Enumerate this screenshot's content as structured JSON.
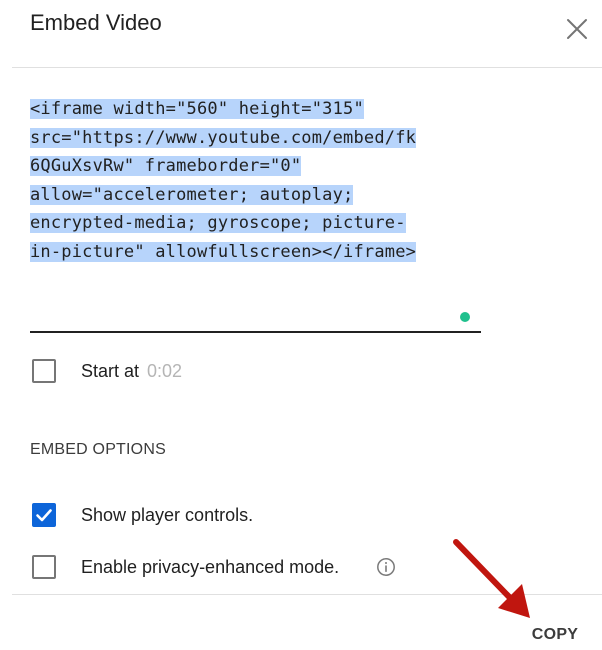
{
  "dialog": {
    "title": "Embed Video",
    "close_icon": "close-icon"
  },
  "embed_code": {
    "lines": [
      "<iframe width=\"560\" height=\"315\"",
      "src=\"https://www.youtube.com/embed/fk",
      "6QGuXsvRw\" frameborder=\"0\"",
      "allow=\"accelerometer; autoplay;",
      "encrypted-media; gyroscope; picture-",
      "in-picture\" allowfullscreen></iframe>"
    ],
    "selected": true
  },
  "start_at": {
    "label": "Start at",
    "time": "0:02",
    "checked": false
  },
  "embed_options": {
    "title": "EMBED OPTIONS",
    "items": [
      {
        "label": "Show player controls.",
        "checked": true
      },
      {
        "label": "Enable privacy-enhanced mode.",
        "checked": false,
        "icon": "info-icon"
      }
    ]
  },
  "footer": {
    "copy_label": "COPY"
  },
  "colors": {
    "selection": "#b7d4fb",
    "checkbox_checked": "#0d65d9",
    "status_dot": "#1fc08d",
    "annotation_arrow": "#c0160f"
  }
}
